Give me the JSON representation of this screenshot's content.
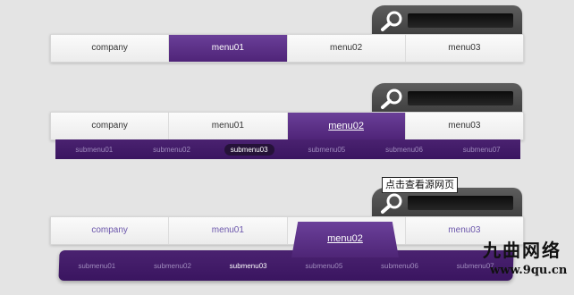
{
  "menu1": {
    "items": [
      "company",
      "menu01",
      "menu02",
      "menu03"
    ]
  },
  "menu2": {
    "items": [
      "company",
      "menu01",
      "menu02",
      "menu03"
    ],
    "submenu": [
      "submenu01",
      "submenu02",
      "submenu03",
      "submenu05",
      "submenu06",
      "submenu07"
    ]
  },
  "menu3": {
    "items": [
      "company",
      "menu01",
      "menu02",
      "menu03"
    ],
    "submenu": [
      "submenu01",
      "submenu02",
      "submenu03",
      "submenu05",
      "submenu06",
      "submenu07"
    ]
  },
  "tooltip": "点击查看源网页",
  "watermark": {
    "name": "九曲网络",
    "url": "www.9qu.cn"
  },
  "colors": {
    "accent": "#4f2478",
    "submenu_bg": "#3a1560",
    "search_bg": "#4a4a4a"
  },
  "icons": [
    "search-icon"
  ]
}
